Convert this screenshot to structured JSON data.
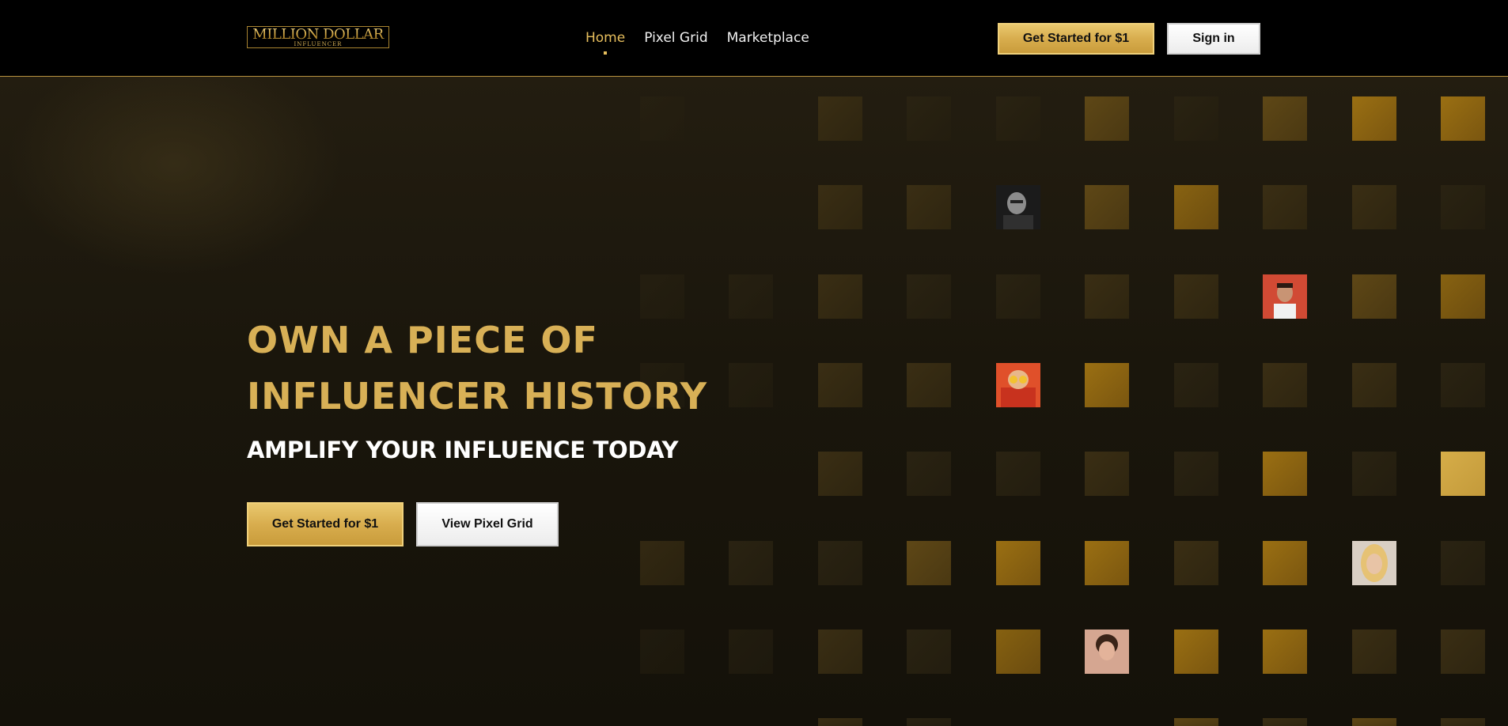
{
  "brand": {
    "logo_main": "MILLION DOLLAR",
    "logo_sub": "INFLUENCER"
  },
  "nav": {
    "links": [
      {
        "label": "Home",
        "active": true
      },
      {
        "label": "Pixel Grid",
        "active": false
      },
      {
        "label": "Marketplace",
        "active": false
      }
    ],
    "cta_label": "Get Started for $1",
    "signin_label": "Sign in"
  },
  "hero": {
    "title_line1": "OWN A PIECE OF",
    "title_line2": "INFLUENCER HISTORY",
    "subtitle": "AMPLIFY YOUR INFLUENCE TODAY",
    "primary_button": "Get Started for $1",
    "secondary_button": "View Pixel Grid"
  },
  "colors": {
    "gold": "#d8b056",
    "nav_active": "#e6be5d",
    "background": "#161308",
    "navbar": "#000000"
  }
}
